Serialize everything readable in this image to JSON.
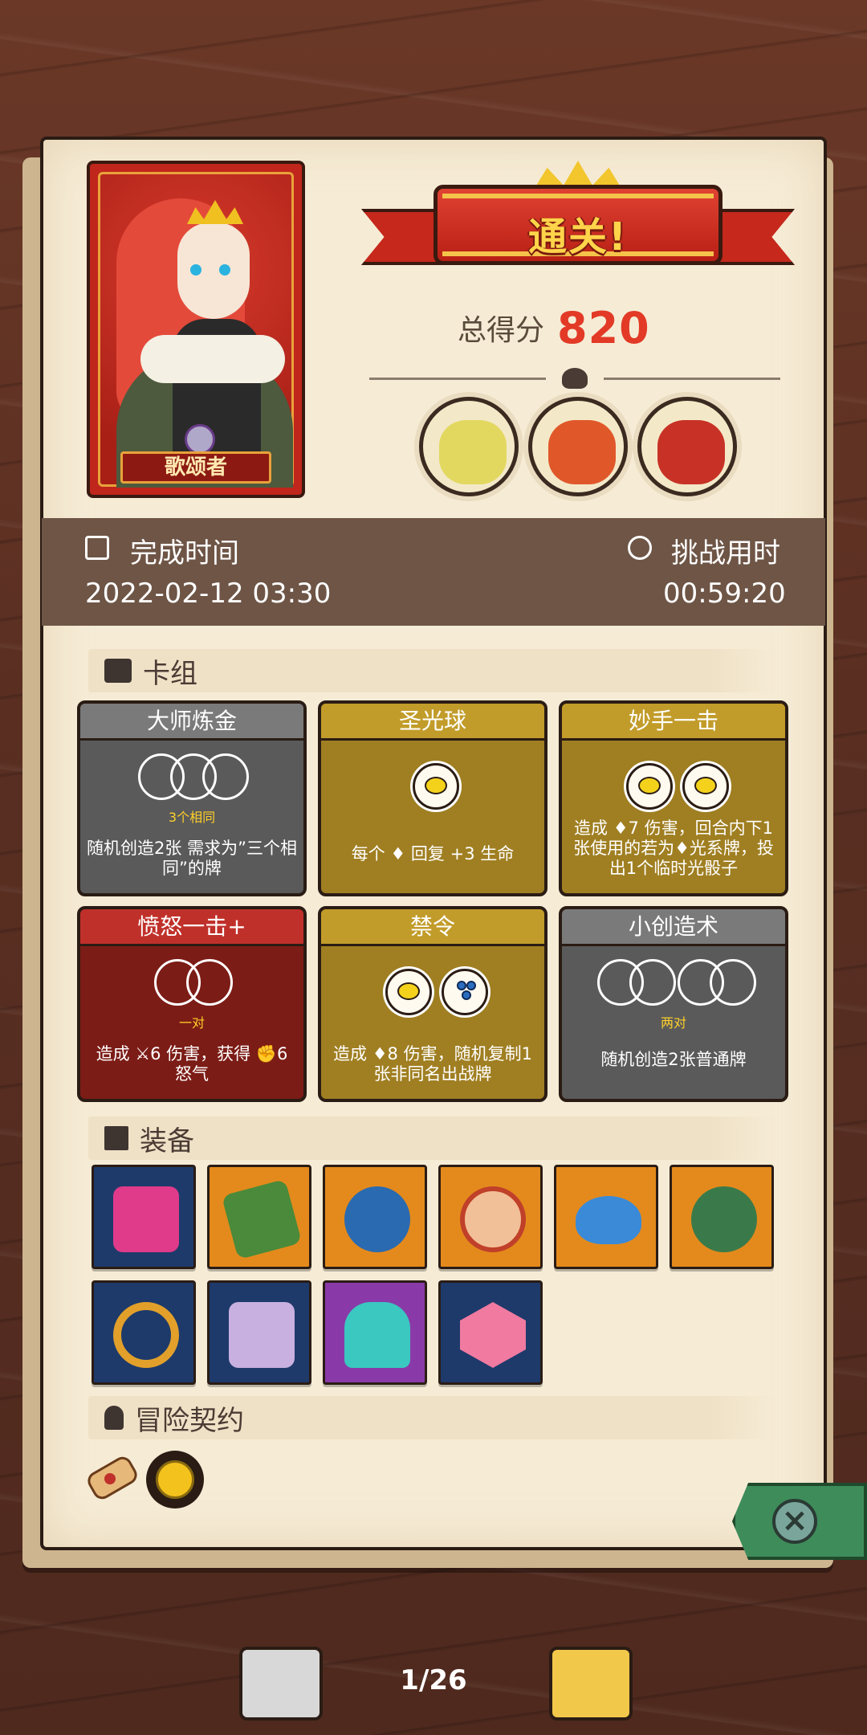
{
  "hero": {
    "name": "歌颂者"
  },
  "result": {
    "banner": "通关!",
    "score_label": "总得分",
    "score_value": "820"
  },
  "bosses": [
    {
      "name": "bone-dinosaur-boss",
      "color": "#e2d860"
    },
    {
      "name": "troll-boss",
      "color": "#e0582a"
    },
    {
      "name": "goblin-king-boss",
      "color": "#c83226"
    }
  ],
  "info": {
    "complete_label": "完成时间",
    "complete_value": "2022-02-12 03:30",
    "challenge_label": "挑战用时",
    "challenge_value": "00:59:20"
  },
  "sections": {
    "deck": "卡组",
    "equipment": "装备",
    "contract": "冒险契约"
  },
  "cards": [
    {
      "title": "大师炼金",
      "sub": "3个相同",
      "desc": "随机创造2张 需求为”三个相同”的牌",
      "style": "gray"
    },
    {
      "title": "圣光球",
      "sub": "",
      "desc": "每个 ♦ 回复 +3 生命",
      "style": "gold"
    },
    {
      "title": "妙手一击",
      "sub": "",
      "desc": "造成 ♦7 伤害，回合内下1张使用的若为♦光系牌，投出1个临时光骰子",
      "style": "gold"
    },
    {
      "title": "愤怒一击+",
      "sub": "一对",
      "desc": "造成 ⚔6 伤害，获得 ✊6 怒气",
      "style": "red"
    },
    {
      "title": "禁令",
      "sub": "",
      "desc": "造成 ♦8 伤害，随机复制1张非同名出战牌",
      "style": "gold"
    },
    {
      "title": "小创造术",
      "sub": "两对",
      "desc": "随机创造2张普通牌",
      "style": "gray"
    }
  ],
  "equipment": [
    {
      "name": "totem-icon",
      "bg": "blue",
      "color": "#e03a8a"
    },
    {
      "name": "moss-stone-icon",
      "bg": "orange",
      "color": "#4a8a3a"
    },
    {
      "name": "spiked-ball-icon",
      "bg": "orange",
      "color": "#2a6ab0"
    },
    {
      "name": "donut-charm-icon",
      "bg": "orange",
      "color": "#f2c098"
    },
    {
      "name": "blue-slime-icon",
      "bg": "orange",
      "color": "#3a8ad8"
    },
    {
      "name": "turtle-shell-icon",
      "bg": "orange",
      "color": "#3a7a4a"
    },
    {
      "name": "gem-ring-icon",
      "bg": "blue",
      "color": "#e2a02a"
    },
    {
      "name": "skull-book-icon",
      "bg": "blue",
      "color": "#c8b0e0"
    },
    {
      "name": "crystal-crown-icon",
      "bg": "purple",
      "color": "#3ac8c0"
    },
    {
      "name": "d20-dice-icon",
      "bg": "blue",
      "color": "#f07aa0"
    }
  ],
  "contracts": [
    {
      "name": "scroll-icon"
    },
    {
      "name": "lemon-coin-icon"
    }
  ],
  "pager": {
    "label": "1/26"
  }
}
